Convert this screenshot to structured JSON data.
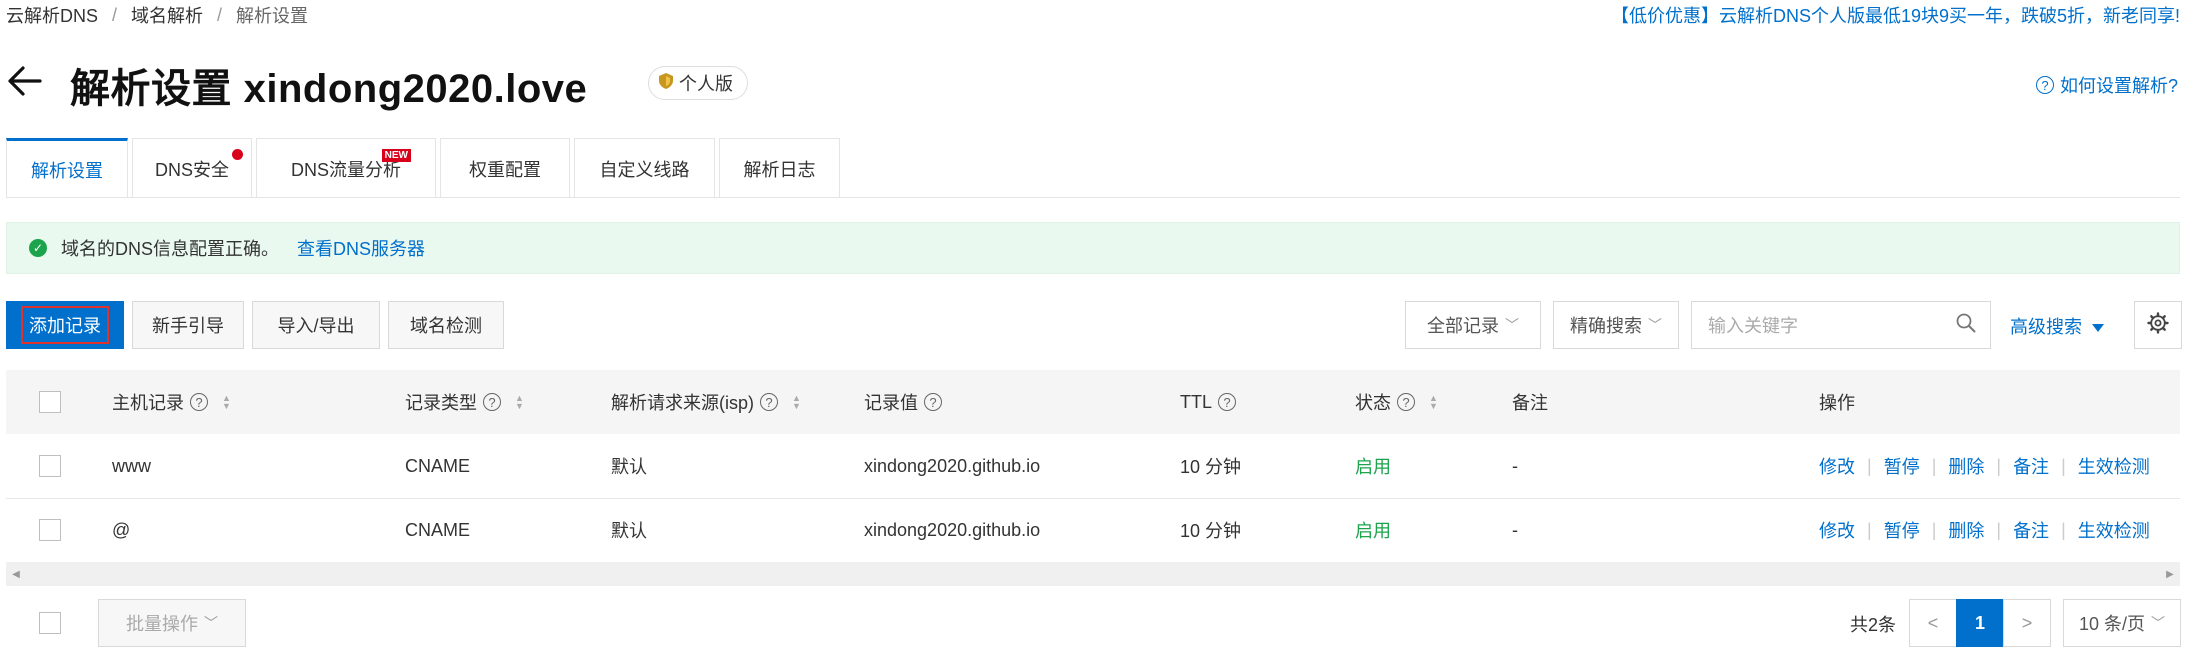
{
  "breadcrumb": [
    "云解析DNS",
    "域名解析",
    "解析设置"
  ],
  "promo": "【低价优惠】云解析DNS个人版最低19块9买一年，跌破5折，新老同享!",
  "header": {
    "title": "解析设置 xindong2020.love",
    "badge": "个人版",
    "help": "如何设置解析?"
  },
  "tabs": [
    {
      "label": "解析设置",
      "active": true
    },
    {
      "label": "DNS安全",
      "dot": true
    },
    {
      "label": "DNS流量分析",
      "new": "NEW"
    },
    {
      "label": "权重配置"
    },
    {
      "label": "自定义线路"
    },
    {
      "label": "解析日志"
    }
  ],
  "notice": {
    "text": "域名的DNS信息配置正确。",
    "link": "查看DNS服务器"
  },
  "toolbar": {
    "add": "添加记录",
    "guide": "新手引导",
    "import_export": "导入/导出",
    "check": "域名检测",
    "filter": "全部记录",
    "match": "精确搜索",
    "search_placeholder": "输入关键字",
    "advanced": "高级搜索"
  },
  "table": {
    "headers": [
      "主机记录",
      "记录类型",
      "解析请求来源(isp)",
      "记录值",
      "TTL",
      "状态",
      "备注",
      "操作"
    ],
    "rows": [
      {
        "host": "www",
        "type": "CNAME",
        "isp": "默认",
        "value": "xindong2020.github.io",
        "ttl": "10 分钟",
        "status": "启用",
        "remark": "-"
      },
      {
        "host": "@",
        "type": "CNAME",
        "isp": "默认",
        "value": "xindong2020.github.io",
        "ttl": "10 分钟",
        "status": "启用",
        "remark": "-"
      }
    ],
    "actions": [
      "修改",
      "暂停",
      "删除",
      "备注",
      "生效检测"
    ]
  },
  "footer": {
    "batch": "批量操作",
    "total": "共2条",
    "page": "1",
    "page_size": "10 条/页"
  },
  "colors": {
    "primary": "#0070cc",
    "success": "#1ba44c",
    "danger": "#d9001b"
  }
}
